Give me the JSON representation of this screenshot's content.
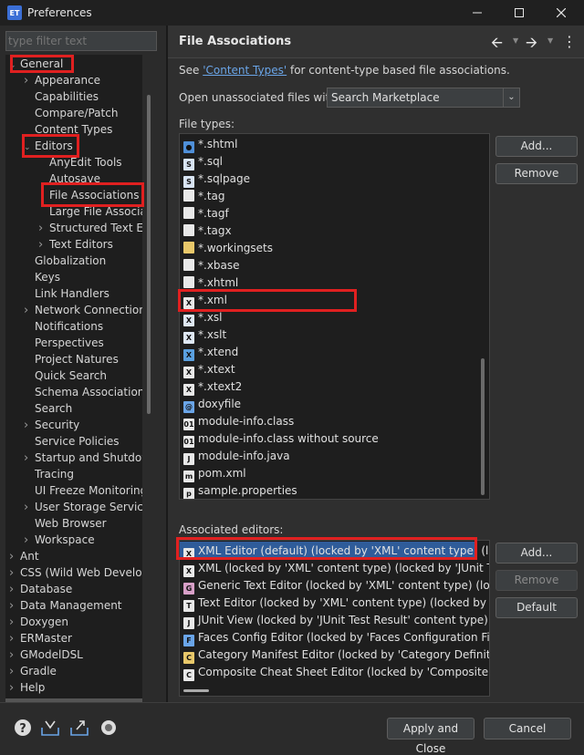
{
  "window": {
    "title": "Preferences",
    "icon_text": "ET"
  },
  "filter": {
    "placeholder": "type filter text"
  },
  "tree": {
    "items": [
      {
        "label": "General",
        "arrow": "expanded"
      },
      {
        "label": "Appearance",
        "arrow": "collapsed"
      },
      {
        "label": "Capabilities",
        "arrow": ""
      },
      {
        "label": "Compare/Patch",
        "arrow": ""
      },
      {
        "label": "Content Types",
        "arrow": ""
      },
      {
        "label": "Editors",
        "arrow": "expanded"
      },
      {
        "label": "AnyEdit Tools",
        "arrow": ""
      },
      {
        "label": "Autosave",
        "arrow": ""
      },
      {
        "label": "File Associations",
        "arrow": ""
      },
      {
        "label": "Large File Associa",
        "arrow": ""
      },
      {
        "label": "Structured Text Ed",
        "arrow": "collapsed"
      },
      {
        "label": "Text Editors",
        "arrow": "collapsed"
      },
      {
        "label": "Globalization",
        "arrow": ""
      },
      {
        "label": "Keys",
        "arrow": ""
      },
      {
        "label": "Link Handlers",
        "arrow": ""
      },
      {
        "label": "Network Connection",
        "arrow": "collapsed"
      },
      {
        "label": "Notifications",
        "arrow": ""
      },
      {
        "label": "Perspectives",
        "arrow": ""
      },
      {
        "label": "Project Natures",
        "arrow": ""
      },
      {
        "label": "Quick Search",
        "arrow": ""
      },
      {
        "label": "Schema Associations",
        "arrow": ""
      },
      {
        "label": "Search",
        "arrow": ""
      },
      {
        "label": "Security",
        "arrow": "collapsed"
      },
      {
        "label": "Service Policies",
        "arrow": ""
      },
      {
        "label": "Startup and Shutdow",
        "arrow": "collapsed"
      },
      {
        "label": "Tracing",
        "arrow": ""
      },
      {
        "label": "UI Freeze Monitoring",
        "arrow": ""
      },
      {
        "label": "User Storage Service",
        "arrow": "collapsed"
      },
      {
        "label": "Web Browser",
        "arrow": ""
      },
      {
        "label": "Workspace",
        "arrow": "collapsed"
      },
      {
        "label": "Ant",
        "arrow": "collapsed"
      },
      {
        "label": "CSS (Wild Web Develop",
        "arrow": "collapsed"
      },
      {
        "label": "Database",
        "arrow": "collapsed"
      },
      {
        "label": "Data Management",
        "arrow": "collapsed"
      },
      {
        "label": "Doxygen",
        "arrow": "collapsed"
      },
      {
        "label": "ERMaster",
        "arrow": "collapsed"
      },
      {
        "label": "GModelDSL",
        "arrow": "collapsed"
      },
      {
        "label": "Gradle",
        "arrow": "collapsed"
      },
      {
        "label": "Help",
        "arrow": "collapsed"
      }
    ]
  },
  "page": {
    "title": "File Associations",
    "see_prefix": "See ",
    "see_link": "'Content Types'",
    "see_suffix": " for content-type based file associations.",
    "open_unassociated_label": "Open unassociated files with:",
    "open_unassociated_value": "Search Marketplace",
    "file_types_label": "File types:",
    "associated_editors_label": "Associated editors:"
  },
  "file_types": [
    {
      "name": "*.shtml",
      "icon": "globe-icon"
    },
    {
      "name": "*.sql",
      "icon": "sql-file-icon"
    },
    {
      "name": "*.sqlpage",
      "icon": "sql-file-icon"
    },
    {
      "name": "*.tag",
      "icon": "file-icon"
    },
    {
      "name": "*.tagf",
      "icon": "file-icon"
    },
    {
      "name": "*.tagx",
      "icon": "file-icon"
    },
    {
      "name": "*.workingsets",
      "icon": "folder-file-icon"
    },
    {
      "name": "*.xbase",
      "icon": "file-icon"
    },
    {
      "name": "*.xhtml",
      "icon": "file-icon"
    },
    {
      "name": "*.xml",
      "icon": "xml-file-icon"
    },
    {
      "name": "*.xsl",
      "icon": "xsl-file-icon"
    },
    {
      "name": "*.xslt",
      "icon": "xsl-file-icon"
    },
    {
      "name": "*.xtend",
      "icon": "xtend-file-icon"
    },
    {
      "name": "*.xtext",
      "icon": "xtext-file-icon"
    },
    {
      "name": "*.xtext2",
      "icon": "xtext-file-icon"
    },
    {
      "name": "doxyfile",
      "icon": "doxygen-icon"
    },
    {
      "name": "module-info.class",
      "icon": "class-file-icon"
    },
    {
      "name": "module-info.class without source",
      "icon": "class-file-icon"
    },
    {
      "name": "module-info.java",
      "icon": "java-file-icon"
    },
    {
      "name": "pom.xml",
      "icon": "maven-file-icon"
    },
    {
      "name": "sample.properties",
      "icon": "properties-file-icon"
    }
  ],
  "editors": [
    {
      "name": "XML Editor (default) (locked by 'XML' content type) (loc",
      "icon": "xml-editor-icon"
    },
    {
      "name": "XML (locked by 'XML' content type) (locked by 'JUnit Te",
      "icon": "xml-editor-icon"
    },
    {
      "name": "Generic Text Editor (locked by 'XML' content type) (lock",
      "icon": "generic-editor-icon"
    },
    {
      "name": "Text Editor (locked by 'XML' content type) (locked by 'JU",
      "icon": "text-editor-icon"
    },
    {
      "name": "JUnit View (locked by 'JUnit Test Result' content type)",
      "icon": "junit-icon"
    },
    {
      "name": "Faces Config Editor (locked by 'Faces Configuration File",
      "icon": "faces-config-icon"
    },
    {
      "name": "Category Manifest Editor (locked by 'Category Definitio",
      "icon": "category-manifest-icon"
    },
    {
      "name": "Composite Cheat Sheet Editor (locked by 'Composite C",
      "icon": "cheat-sheet-icon"
    }
  ],
  "buttons": {
    "file_add": "Add...",
    "file_remove": "Remove",
    "editor_add": "Add...",
    "editor_remove": "Remove",
    "editor_default": "Default",
    "apply_close": "Apply and Close",
    "cancel": "Cancel"
  },
  "colors": {
    "highlight": "#e02020",
    "selection": "#2f5c9a",
    "link": "#6aa5e8"
  }
}
